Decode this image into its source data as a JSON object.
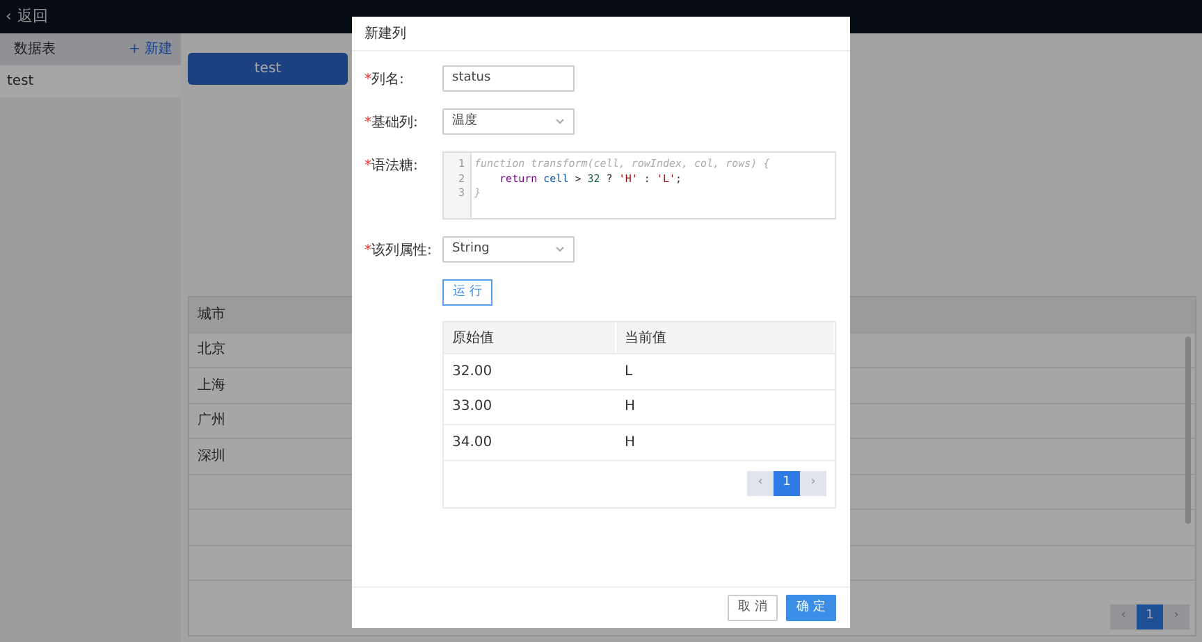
{
  "topbar": {
    "back_icon": "‹",
    "back": "返回"
  },
  "sidebar": {
    "title": "数据表",
    "new_button": "+ 新建",
    "items": [
      {
        "label": "test"
      }
    ]
  },
  "main": {
    "table_button": "test",
    "table": {
      "columns": [
        "城市"
      ],
      "rows": [
        "北京",
        "上海",
        "广州",
        "深圳"
      ]
    },
    "pagination": {
      "prev": "‹",
      "next": "›",
      "pages": [
        {
          "label": "1",
          "selected": true
        }
      ]
    }
  },
  "dialog": {
    "title": "新建列",
    "fields": [
      {
        "kind": "input",
        "mark": "*",
        "label": "列名:",
        "value": "status"
      },
      {
        "kind": "select",
        "mark": "*",
        "label": "基础列:",
        "value": "温度"
      },
      {
        "kind": "code",
        "mark": "*",
        "label": "语法糖:",
        "lines": [
          {
            "number": "1",
            "indented": false,
            "tokens": [
              {
                "kind": "comment",
                "text": "function transform(cell, rowIndex, col, rows) {"
              }
            ]
          },
          {
            "number": "2",
            "indented": true,
            "tokens": [
              {
                "kind": "keyword",
                "text": "return"
              },
              {
                "kind": "variable",
                "text": " cell"
              },
              {
                "kind": "plain",
                "text": " > "
              },
              {
                "kind": "number",
                "text": "32"
              },
              {
                "kind": "plain",
                "text": " ? "
              },
              {
                "kind": "string",
                "text": "'H'"
              },
              {
                "kind": "plain",
                "text": " : "
              },
              {
                "kind": "string",
                "text": "'L'"
              },
              {
                "kind": "plain",
                "text": ";"
              }
            ]
          },
          {
            "number": "3",
            "indented": false,
            "tokens": [
              {
                "kind": "comment",
                "text": "}"
              }
            ]
          }
        ]
      },
      {
        "kind": "select",
        "mark": "*",
        "label": "该列属性:",
        "value": "String"
      }
    ],
    "run_button": "运 行",
    "preview": {
      "columns": [
        "原始值",
        "当前值"
      ],
      "rows": [
        [
          "32.00",
          "L"
        ],
        [
          "33.00",
          "H"
        ],
        [
          "34.00",
          "H"
        ]
      ],
      "pagination": {
        "prev": "‹",
        "next": "›",
        "pages": [
          {
            "label": "1",
            "selected": true
          }
        ]
      }
    },
    "buttons": [
      {
        "kind": "secondary",
        "label": "取 消"
      },
      {
        "kind": "primary",
        "label": "确 定"
      }
    ]
  }
}
